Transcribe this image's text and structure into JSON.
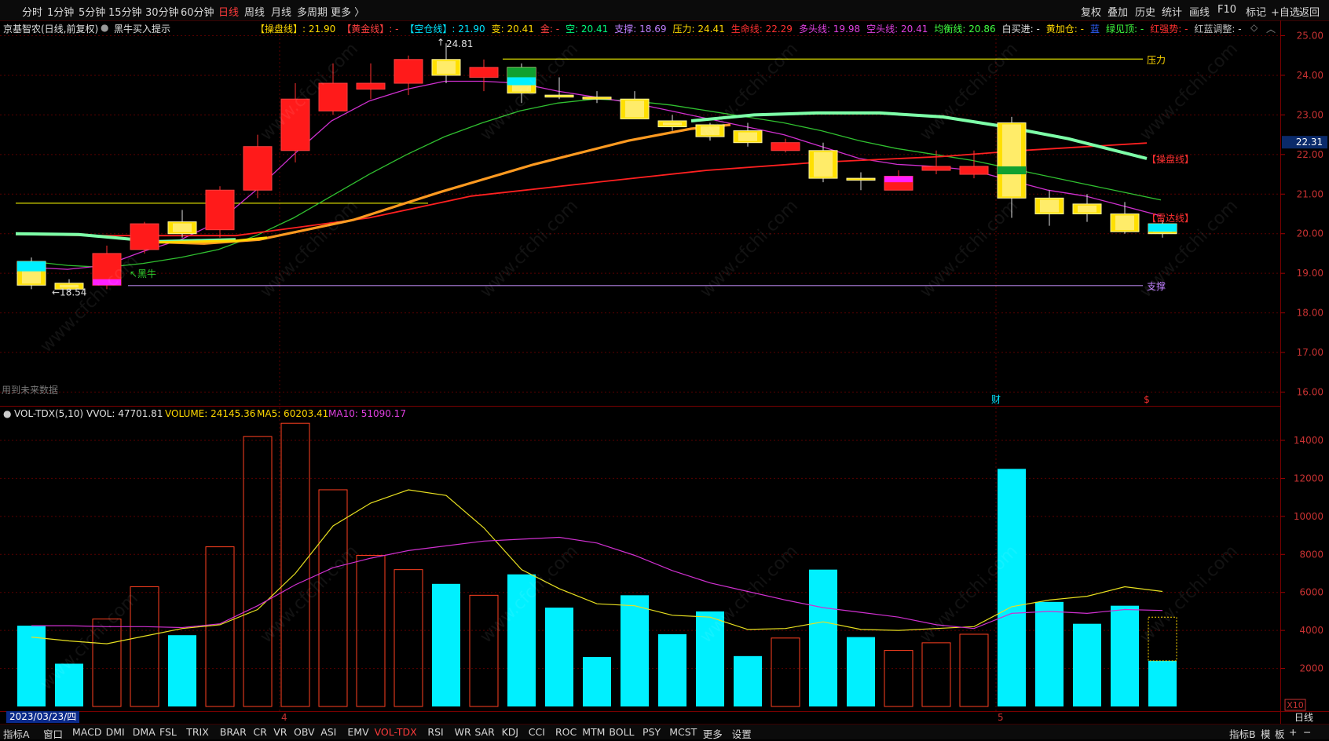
{
  "toolbar": {
    "periods": [
      "分时",
      "1分钟",
      "5分钟",
      "15分钟",
      "30分钟",
      "60分钟",
      "日线",
      "周线",
      "月线",
      "多周期",
      "更多 〉"
    ],
    "active_period": "日线",
    "right_buttons": [
      "复权",
      "叠加",
      "历史",
      "统计",
      "画线",
      "F10",
      "标记",
      "+自选",
      "返回"
    ]
  },
  "stock": {
    "title": "京基智农(日线,前复权)",
    "hint_label": "黑牛买入提示"
  },
  "indicators": [
    {
      "label": "【操盘线】: ",
      "value": "21.90",
      "color": "#ffd800"
    },
    {
      "label": "【黄金线】: ",
      "value": "-",
      "color": "#ff4040"
    },
    {
      "label": "【空仓线】: ",
      "value": "21.90",
      "color": "#00e5ff"
    },
    {
      "label": "变: ",
      "value": "20.41",
      "color": "#ffd800"
    },
    {
      "label": "金: ",
      "value": "-",
      "color": "#ff4040"
    },
    {
      "label": "空: ",
      "value": "20.41",
      "color": "#00ff7f"
    },
    {
      "label": "支撑: ",
      "value": "18.69",
      "color": "#c080ff"
    },
    {
      "label": "压力: ",
      "value": "24.41",
      "color": "#ffd800"
    },
    {
      "label": "生命线: ",
      "value": "22.29",
      "color": "#ff3030"
    },
    {
      "label": "多头线: ",
      "value": "19.98",
      "color": "#e040e0"
    },
    {
      "label": "空头线: ",
      "value": "20.41",
      "color": "#e040e0"
    },
    {
      "label": "均衡线: ",
      "value": "20.86",
      "color": "#40ff40"
    },
    {
      "label": "白买进: ",
      "value": "-",
      "color": "#e0e0e0"
    },
    {
      "label": "黄加仓: ",
      "value": "-",
      "color": "#ffd800"
    },
    {
      "label": "蓝",
      "value": "",
      "color": "#3060ff"
    },
    {
      "label": "绿见顶: ",
      "value": "-",
      "color": "#40ff40"
    },
    {
      "label": "红强势: ",
      "value": "-",
      "color": "#ff3030"
    },
    {
      "label": "红蓝调整: ",
      "value": "-",
      "color": "#c0c0c0"
    }
  ],
  "price_axis": {
    "ticks": [
      "25.00",
      "24.00",
      "23.00",
      "22.00",
      "21.00",
      "20.00",
      "19.00",
      "18.00",
      "17.00",
      "16.00"
    ],
    "current": "22.31"
  },
  "annotations": {
    "high_label": "24.81",
    "low_label": "←18.54",
    "pressure_label": "压力",
    "support_label": "支撑",
    "operate_line_label": "【操盘线】",
    "radar_line_label": "【雷达线】",
    "black_bull_label": "↖黑牛",
    "future_data_label": "用到未来数据",
    "finance_marker": "财",
    "dollar_marker": "$"
  },
  "volume": {
    "name": "VOL-TDX(5,10)",
    "vvol": "VVOL: 47701.81",
    "volume": "VOLUME: 24145.36",
    "ma5": "MA5: 60203.41",
    "ma10": "MA10: 51090.17",
    "axis_ticks": [
      "14000",
      "12000",
      "10000",
      "8000",
      "6000",
      "4000",
      "2000"
    ],
    "unit": "X10"
  },
  "date_badge": "2023/03/23/四",
  "month_markers": [
    "4",
    "5"
  ],
  "bottom_tabs": [
    "指标A",
    "窗口",
    "MACD",
    "DMI",
    "DMA",
    "FSL",
    "TRIX",
    "BRAR",
    "CR",
    "VR",
    "OBV",
    "ASI",
    "EMV",
    "VOL-TDX",
    "RSI",
    "WR",
    "SAR",
    "KDJ",
    "CCI",
    "ROC",
    "MTM",
    "BOLL",
    "PSY",
    "MCST",
    "更多",
    "设置"
  ],
  "active_tab": "VOL-TDX",
  "bottom_right": [
    "指标B",
    "模",
    "板",
    "+",
    "−"
  ],
  "period_label": "日线",
  "watermark": "www.cfchi.com",
  "colors": {
    "up": "#ff2020",
    "down": "#00f0ff",
    "yellow": "#ffd800",
    "magenta": "#e040e0",
    "green": "#30d030",
    "orange": "#ff8c00"
  },
  "chart_data": {
    "type": "candlestick",
    "candles": [
      {
        "o": 19.3,
        "h": 19.4,
        "l": 18.6,
        "c": 18.7,
        "vol": 4250,
        "up": false
      },
      {
        "o": 18.75,
        "h": 18.85,
        "l": 18.54,
        "c": 18.6,
        "vol": 2250,
        "up": false
      },
      {
        "o": 18.7,
        "h": 19.7,
        "l": 18.6,
        "c": 19.5,
        "vol": 4600,
        "up": true
      },
      {
        "o": 19.6,
        "h": 20.3,
        "l": 19.5,
        "c": 20.25,
        "vol": 6300,
        "up": true
      },
      {
        "o": 20.0,
        "h": 20.6,
        "l": 19.9,
        "c": 20.3,
        "vol": 3750,
        "up": false
      },
      {
        "o": 20.1,
        "h": 21.2,
        "l": 19.9,
        "c": 21.1,
        "vol": 8400,
        "up": true
      },
      {
        "o": 21.1,
        "h": 22.5,
        "l": 20.9,
        "c": 22.2,
        "vol": 14200,
        "up": true
      },
      {
        "o": 22.1,
        "h": 23.8,
        "l": 21.8,
        "c": 23.4,
        "vol": 14900,
        "up": true
      },
      {
        "o": 23.1,
        "h": 24.3,
        "l": 23.0,
        "c": 23.8,
        "vol": 11400,
        "up": true
      },
      {
        "o": 23.65,
        "h": 24.3,
        "l": 23.4,
        "c": 23.8,
        "vol": 7950,
        "up": true
      },
      {
        "o": 23.8,
        "h": 24.5,
        "l": 23.5,
        "c": 24.4,
        "vol": 7200,
        "up": true
      },
      {
        "o": 24.0,
        "h": 24.81,
        "l": 23.8,
        "c": 24.4,
        "vol": 6450,
        "up": false
      },
      {
        "o": 24.2,
        "h": 24.4,
        "l": 23.6,
        "c": 23.95,
        "vol": 5850,
        "up": true
      },
      {
        "o": 24.2,
        "h": 24.3,
        "l": 23.3,
        "c": 23.55,
        "vol": 6950,
        "up": false
      },
      {
        "o": 23.5,
        "h": 23.95,
        "l": 23.4,
        "c": 23.45,
        "vol": 5200,
        "up": false
      },
      {
        "o": 23.45,
        "h": 23.6,
        "l": 23.3,
        "c": 23.4,
        "vol": 2600,
        "up": false
      },
      {
        "o": 23.4,
        "h": 23.6,
        "l": 22.9,
        "c": 22.9,
        "vol": 5850,
        "up": false
      },
      {
        "o": 22.85,
        "h": 23.0,
        "l": 22.6,
        "c": 22.7,
        "vol": 3800,
        "up": false
      },
      {
        "o": 22.75,
        "h": 22.8,
        "l": 22.35,
        "c": 22.45,
        "vol": 5000,
        "up": false
      },
      {
        "o": 22.6,
        "h": 22.8,
        "l": 22.2,
        "c": 22.3,
        "vol": 2650,
        "up": false
      },
      {
        "o": 22.3,
        "h": 22.4,
        "l": 22.05,
        "c": 22.1,
        "vol": 3600,
        "up": true
      },
      {
        "o": 22.1,
        "h": 22.3,
        "l": 21.3,
        "c": 21.4,
        "vol": 7200,
        "up": false
      },
      {
        "o": 21.4,
        "h": 21.55,
        "l": 21.1,
        "c": 21.35,
        "vol": 3650,
        "up": false
      },
      {
        "o": 21.45,
        "h": 21.6,
        "l": 21.1,
        "c": 21.1,
        "vol": 2950,
        "up": true
      },
      {
        "o": 21.6,
        "h": 22.1,
        "l": 21.5,
        "c": 21.7,
        "vol": 3350,
        "up": true
      },
      {
        "o": 21.5,
        "h": 22.1,
        "l": 21.4,
        "c": 21.7,
        "vol": 3800,
        "up": true
      },
      {
        "o": 22.8,
        "h": 22.95,
        "l": 20.4,
        "c": 20.9,
        "vol": 12500,
        "up": false
      },
      {
        "o": 20.9,
        "h": 21.1,
        "l": 20.2,
        "c": 20.5,
        "vol": 5500,
        "up": false
      },
      {
        "o": 20.75,
        "h": 21.0,
        "l": 20.3,
        "c": 20.5,
        "vol": 4350,
        "up": false
      },
      {
        "o": 20.5,
        "h": 20.8,
        "l": 20.0,
        "c": 20.05,
        "vol": 5300,
        "up": false
      },
      {
        "o": 20.25,
        "h": 20.35,
        "l": 19.9,
        "c": 20.0,
        "vol": 2400,
        "up": false
      }
    ],
    "series": [
      {
        "name": "MA5",
        "values": [
          3650,
          3450,
          3300,
          3700,
          4100,
          4300,
          5100,
          7000,
          9500,
          10700,
          11400,
          11100,
          9400,
          7200,
          6200,
          5400,
          5300,
          4800,
          4700,
          4050,
          4100,
          4450,
          4050,
          4000,
          4100,
          4200,
          5250,
          5600,
          5800,
          6300,
          6050
        ]
      },
      {
        "name": "MA10",
        "values": [
          4250,
          4250,
          4200,
          4200,
          4150,
          4350,
          5300,
          6400,
          7300,
          7800,
          8200,
          8450,
          8700,
          8800,
          8900,
          8600,
          7950,
          7150,
          6500,
          6050,
          5600,
          5200,
          4950,
          4700,
          4300,
          4100,
          4900,
          5000,
          4900,
          5100,
          5050
        ]
      }
    ],
    "price_ylim": [
      16.0,
      25.0
    ],
    "volume_ylim": [
      0,
      15000
    ]
  }
}
